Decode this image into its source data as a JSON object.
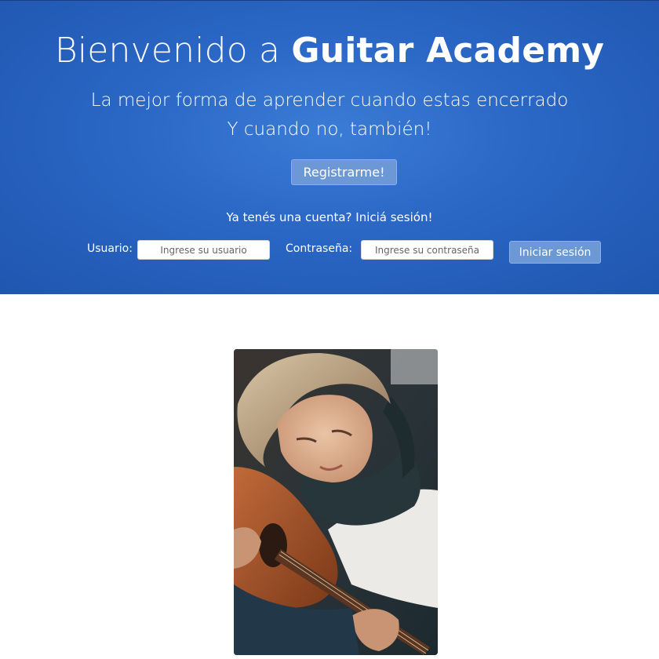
{
  "hero": {
    "title_prefix": "Bienvenido a ",
    "title_brand": "Guitar Academy",
    "tagline_line1": "La mejor forma de aprender cuando estas encerrado",
    "tagline_line2": "Y cuando no, también!",
    "register_label": "Registrarme!",
    "background_color": "#2a66c4"
  },
  "login": {
    "prompt": "Ya tenés una cuenta? Iniciá sesión!",
    "username_label": "Usuario:",
    "username_placeholder": "Ingrese su usuario",
    "password_label": "Contraseña:",
    "password_placeholder": "Ingrese su contraseña",
    "submit_label": "Iniciar sesión"
  },
  "main": {
    "image_icon": "woman-playing-guitar-photo"
  }
}
